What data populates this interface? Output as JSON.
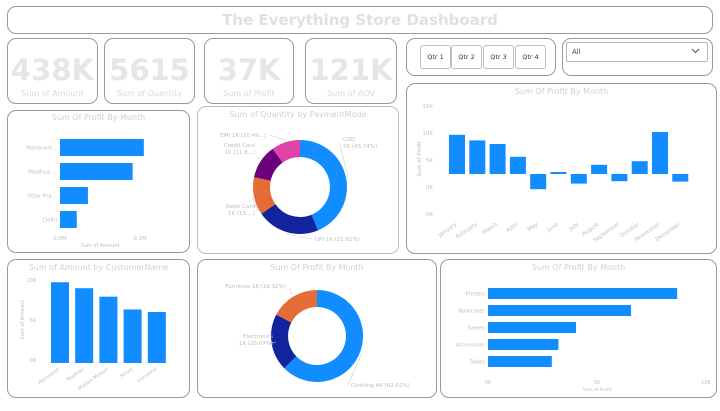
{
  "dashboard": {
    "title": "The Everything Store Dashboard"
  },
  "kpis": [
    {
      "value": "438K",
      "label": "Sum of Amount"
    },
    {
      "value": "5615",
      "label": "Sum of Quantity"
    },
    {
      "value": "37K",
      "label": "Sum of Profit"
    },
    {
      "value": "121K",
      "label": "Sum of AOV"
    }
  ],
  "quarter_slicer": {
    "buttons": [
      "Qtr 1",
      "Qtr 2",
      "Qtr 3",
      "Qtr 4"
    ]
  },
  "dropdown": {
    "selected": "All"
  },
  "colors": {
    "accent": "#118dff",
    "navy": "#12239e",
    "orange": "#e66c37",
    "purple": "#6b007b",
    "pink": "#e044a7"
  },
  "chart_data": [
    {
      "id": "profit_by_state",
      "type": "bar",
      "orientation": "horizontal",
      "title": "Sum Of Profit By Month",
      "categories": [
        "Maharast...",
        "Madhya ...",
        "Uttar Pra...",
        "Delhi"
      ],
      "values": [
        3.0,
        2.6,
        1.0,
        0.6
      ],
      "xlabel": "Sum of Amount",
      "x_ticks": [
        "0.0M",
        "0.1M"
      ],
      "xlim": [
        0,
        3.4
      ]
    },
    {
      "id": "quantity_by_paymentmode",
      "type": "pie",
      "donut": true,
      "title": "Sum of Quantity by PaymentMode",
      "slices": [
        {
          "label": "COD 2K (43.74%)",
          "value": 43.74,
          "color": "#118dff"
        },
        {
          "label": "UPI 1K (21.61%)",
          "value": 21.61,
          "color": "#12239e"
        },
        {
          "label": "Debit Card 1K (13....)",
          "value": 13.0,
          "color": "#e66c37"
        },
        {
          "label": "Credit Card 1K (11.8...)",
          "value": 11.8,
          "color": "#6b007b"
        },
        {
          "label": "EMI 1K (10.49...)",
          "value": 9.85,
          "color": "#e044a7"
        }
      ]
    },
    {
      "id": "profit_by_month",
      "type": "bar",
      "title": "Sum Of Profit By Month",
      "categories": [
        "January",
        "February",
        "March",
        "April",
        "May",
        "June",
        "July",
        "August",
        "September",
        "October",
        "November",
        "December"
      ],
      "values": [
        9.8,
        8.4,
        7.5,
        4.3,
        -3.8,
        0.5,
        -2.4,
        2.3,
        -1.8,
        3.2,
        10.5,
        -1.9
      ],
      "ylabel": "Sum of Profit",
      "y_ticks": [
        "-5K",
        "0K",
        "5K",
        "10K",
        "15K"
      ],
      "ylim": [
        -10,
        16
      ]
    },
    {
      "id": "amount_by_customer",
      "type": "bar",
      "title": "Sum of Amount by CustomerName",
      "categories": [
        "Harivansh",
        "Madhav",
        "Madan Mohan",
        "Shiva",
        "Vishakha"
      ],
      "values": [
        9.5,
        8.8,
        7.8,
        6.3,
        6.0
      ],
      "ylabel": "Sum of Amount",
      "y_ticks": [
        "0K",
        "5K",
        "10K"
      ],
      "ylim": [
        0,
        10
      ]
    },
    {
      "id": "profit_by_category",
      "type": "pie",
      "donut": true,
      "title": "Sum Of Profit By Month",
      "slices": [
        {
          "label": "Clothing 4K (62.62%)",
          "value": 62.62,
          "color": "#118dff"
        },
        {
          "label": "Electronics 1K (20.07%)",
          "value": 20.07,
          "color": "#12239e"
        },
        {
          "label": "Furniture 1K (16.32%)",
          "value": 17.31,
          "color": "#e66c37"
        }
      ]
    },
    {
      "id": "profit_by_subcategory",
      "type": "bar",
      "orientation": "horizontal",
      "title": "Sum Of Profit By Month",
      "categories": [
        "Printers",
        "Bookcases",
        "Sarees",
        "Accessories",
        "Tables"
      ],
      "values": [
        8.6,
        6.5,
        4.0,
        3.2,
        2.9
      ],
      "xlabel": "Sum of Profit",
      "x_ticks": [
        "0K",
        "5K",
        "10K"
      ],
      "xlim": [
        0,
        10
      ]
    }
  ]
}
